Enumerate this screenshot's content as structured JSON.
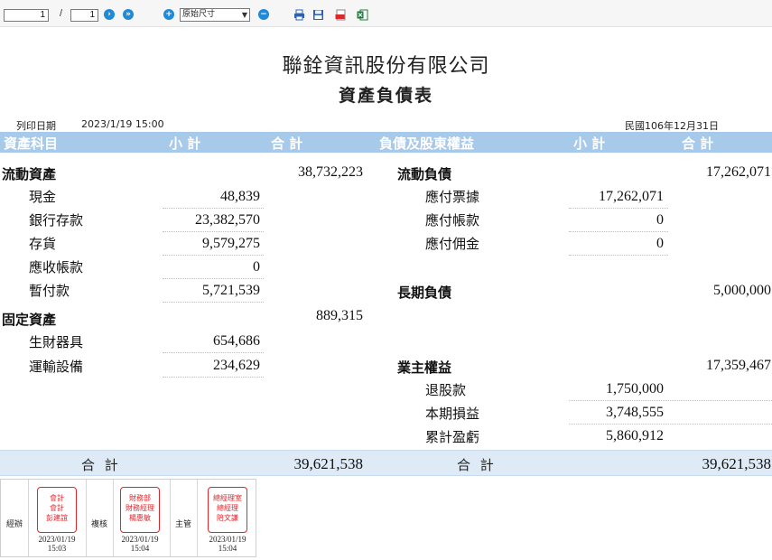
{
  "toolbar": {
    "current_page": "1",
    "page_separator": "/",
    "total_pages": "1",
    "next_glyph": "›",
    "last_glyph": "»",
    "zoom_in_glyph": "+",
    "zoom_out_glyph": "−",
    "zoom_value": "原始尺寸",
    "icons": [
      "print-icon",
      "save-icon",
      "pdf-icon",
      "excel-icon"
    ]
  },
  "report": {
    "company": "聯銓資訊股份有限公司",
    "title": "資產負債表",
    "print_date_label": "列印日期",
    "print_date": "2023/1/19 15:00",
    "period": "民國106年12月31日"
  },
  "header": {
    "assets": "資產科目",
    "subtotal": "小 計",
    "total": "合 計",
    "liabilities": "負債及股東權益",
    "subtotal2": "小 計",
    "total2": "合 計"
  },
  "assets": {
    "current": {
      "label": "流動資產",
      "total": "38,732,223"
    },
    "items": [
      {
        "label": "現金",
        "value": "48,839"
      },
      {
        "label": "銀行存款",
        "value": "23,382,570"
      },
      {
        "label": "存貨",
        "value": "9,579,275"
      },
      {
        "label": "應收帳款",
        "value": "0"
      },
      {
        "label": "暫付款",
        "value": "5,721,539"
      }
    ],
    "fixed": {
      "label": "固定資產",
      "total": "889,315"
    },
    "fixed_items": [
      {
        "label": "生財器具",
        "value": "654,686"
      },
      {
        "label": "運輸設備",
        "value": "234,629"
      }
    ]
  },
  "liabilities": {
    "current": {
      "label": "流動負債",
      "total": "17,262,071"
    },
    "items": [
      {
        "label": "應付票據",
        "value": "17,262,071"
      },
      {
        "label": "應付帳款",
        "value": "0"
      },
      {
        "label": "應付佣金",
        "value": "0"
      }
    ],
    "longterm": {
      "label": "長期負債",
      "total": "5,000,000"
    },
    "equity": {
      "label": "業主權益",
      "total": "17,359,467"
    },
    "equity_items": [
      {
        "label": "退股款",
        "value": "1,750,000"
      },
      {
        "label": "本期損益",
        "value": "3,748,555"
      },
      {
        "label": "累計盈虧",
        "value": "5,860,912"
      }
    ]
  },
  "totals": {
    "left_label": "合 計",
    "left_value": "39,621,538",
    "right_label": "合 計",
    "right_value": "39,621,538"
  },
  "approval": {
    "role1": "經辦",
    "stamp1": [
      "會計",
      "會計",
      "彭建誼"
    ],
    "date1": [
      "2023/01/19",
      "15:03"
    ],
    "role2": "複核",
    "stamp2": [
      "財務部",
      "財務經理",
      "楊惠敏"
    ],
    "date2": [
      "2023/01/19",
      "15:04"
    ],
    "role3": "主管",
    "stamp3": [
      "總經理室",
      "總經理",
      "陪文謙"
    ],
    "date3": [
      "2023/01/19",
      "15:04"
    ]
  },
  "colors": {
    "header_band": "#a7c9ea",
    "total_band": "#deebf7",
    "stamp_red": "#e0262b",
    "toolbar_blue": "#1f8ad6"
  }
}
